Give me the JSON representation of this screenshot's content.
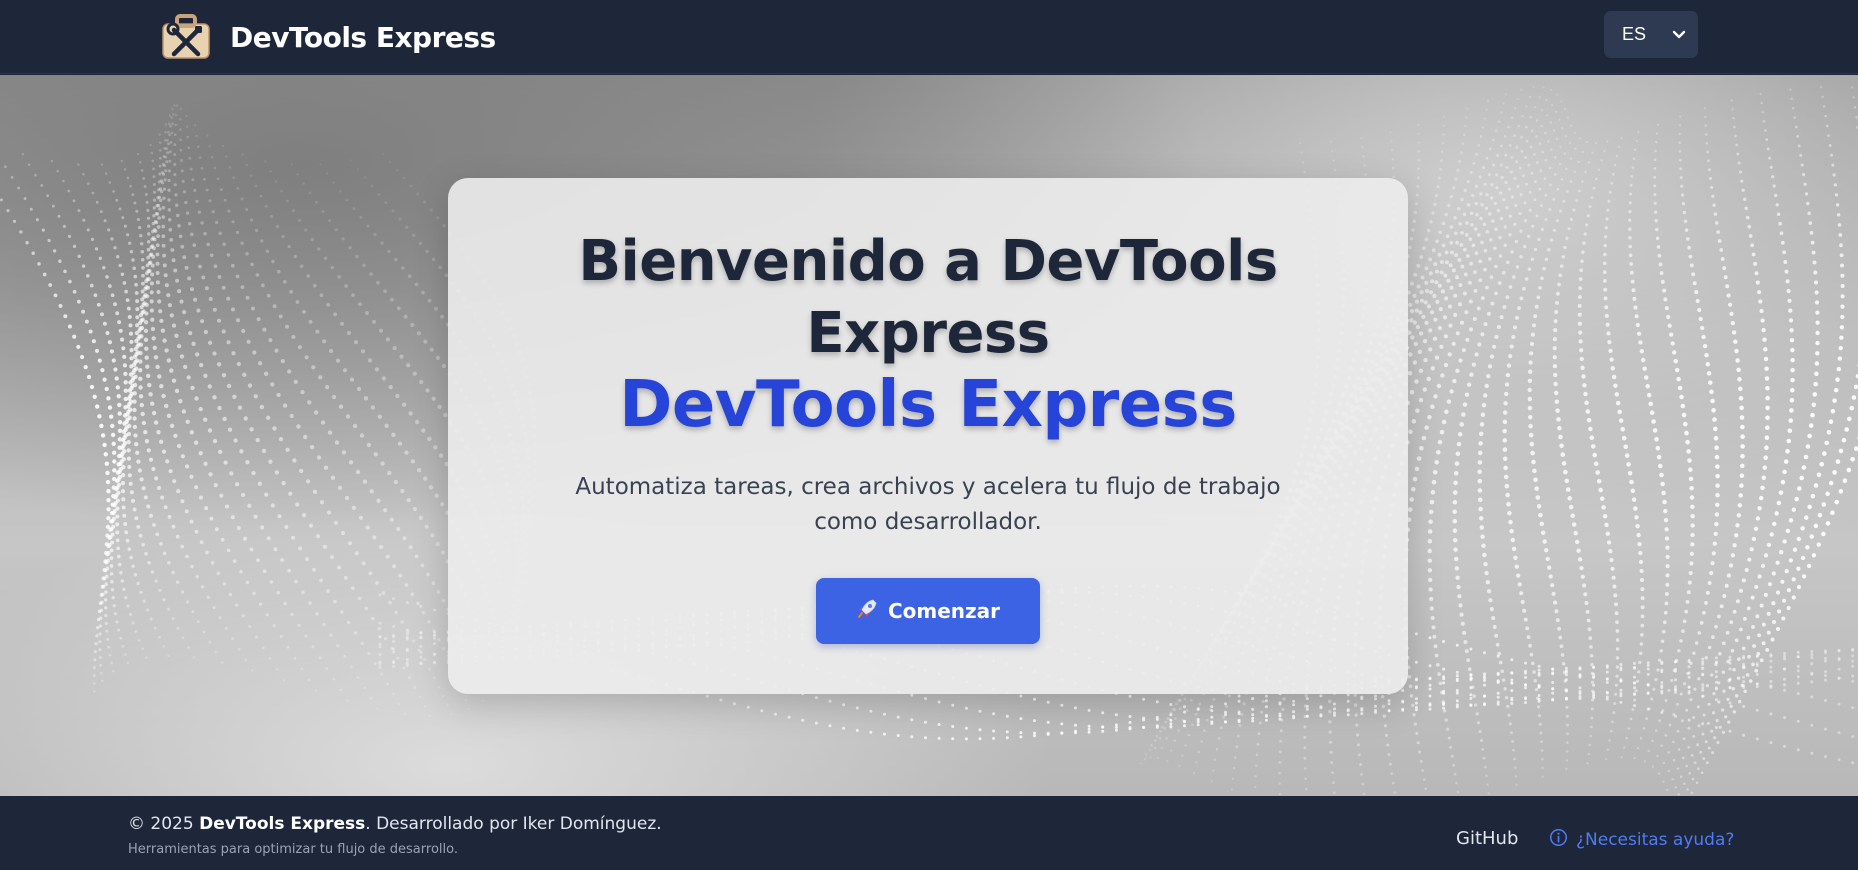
{
  "header": {
    "brand_name": "DevTools Express",
    "logo_icon": "toolbox-icon",
    "language": {
      "selected": "ES"
    }
  },
  "hero": {
    "title_line1": "Bienvenido a DevTools",
    "title_line2": "Express",
    "brand_highlight": "DevTools Express",
    "subtitle": "Automatiza tareas, crea archivos y acelera tu flujo de trabajo como desarrollador.",
    "cta": {
      "icon": "rocket-icon",
      "label": "Comenzar"
    }
  },
  "footer": {
    "copyright_prefix": "© 2025 ",
    "copyright_brand": "DevTools Express",
    "copyright_suffix": ". Desarrollado por Iker Domínguez.",
    "tagline": "Herramientas para optimizar tu flujo de desarrollo.",
    "github_label": "GitHub",
    "help_label": "¿Necesitas ayuda?",
    "help_icon": "info-icon"
  },
  "colors": {
    "navbar_bg": "#1e2639",
    "accent_blue": "#2744d9",
    "button_blue": "#3b63e3",
    "help_link": "#4f7cf5"
  }
}
